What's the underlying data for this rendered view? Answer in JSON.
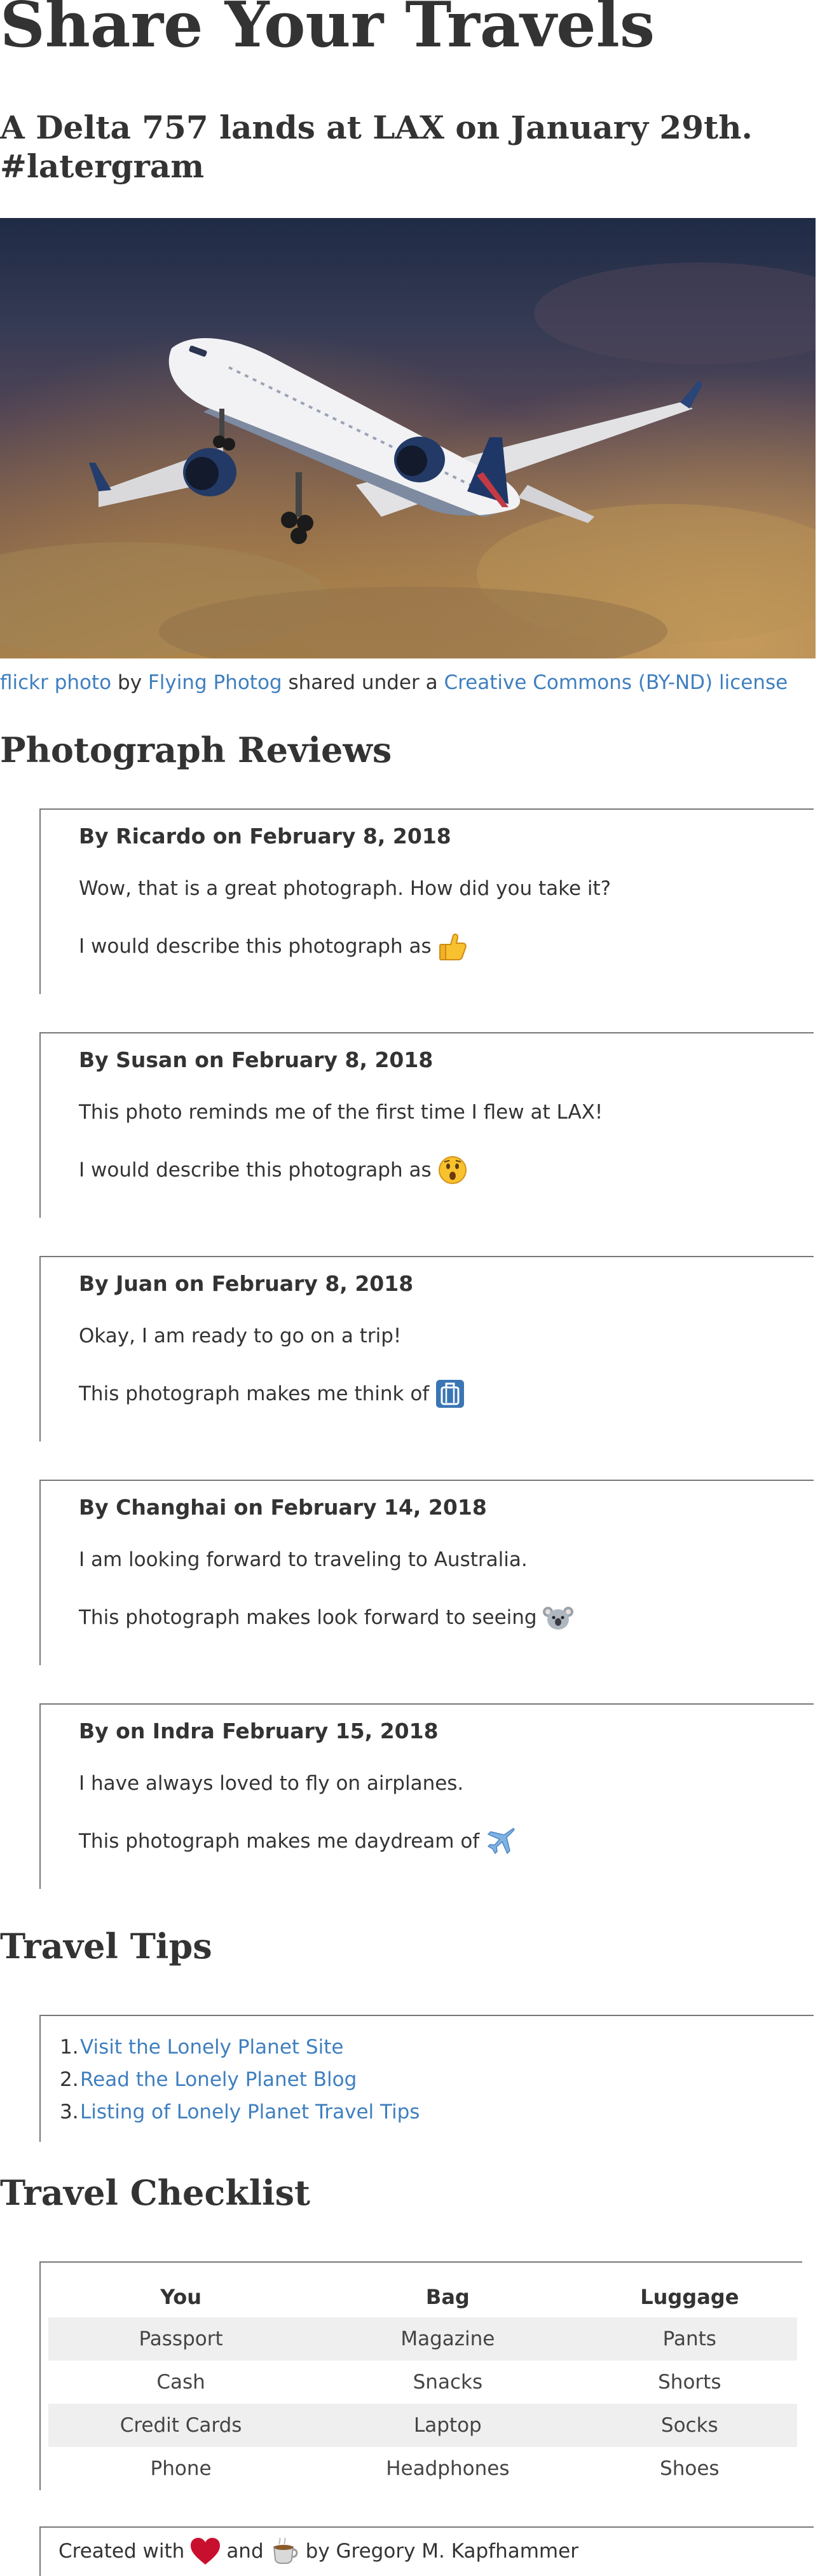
{
  "page": {
    "title": "Share Your Travels",
    "photo_title": "A Delta 757 lands at LAX on January 29th. #latergram"
  },
  "photo": {
    "alt_subject": "Delta 757 airplane in flight"
  },
  "caption": {
    "link1": "flickr photo",
    "by": "by",
    "link2": "Flying Photog",
    "shared": "shared under a",
    "link3": "Creative Commons (BY-ND) license"
  },
  "reviews": {
    "heading": "Photograph Reviews",
    "items": [
      {
        "author": "By Ricardo on February 8, 2018",
        "comment": "Wow, that is a great photograph. How did you take it?",
        "emoji_text": "I would describe this photograph as",
        "emoji_icon": "thumbs-up-icon"
      },
      {
        "author": "By Susan on February 8, 2018",
        "comment": "This photo reminds me of the first time I flew at LAX!",
        "emoji_text": "I would describe this photograph as",
        "emoji_icon": "astonished-face-icon"
      },
      {
        "author": "By Juan on February 8, 2018",
        "comment": "Okay, I am ready to go on a trip!",
        "emoji_text": "This photograph makes me think of",
        "emoji_icon": "luggage-icon"
      },
      {
        "author": "By Changhai on February 14, 2018",
        "comment": "I am looking forward to traveling to Australia.",
        "emoji_text": "This photograph makes look forward to seeing",
        "emoji_icon": "koala-icon"
      },
      {
        "author": "By on Indra February 15, 2018",
        "comment": "I have always loved to fly on airplanes.",
        "emoji_text": "This photograph makes me daydream of",
        "emoji_icon": "airplane-icon"
      }
    ]
  },
  "tips": {
    "heading": "Travel Tips",
    "items": [
      {
        "num": "1.",
        "label": "Visit the Lonely Planet Site"
      },
      {
        "num": "2.",
        "label": "Read the Lonely Planet Blog"
      },
      {
        "num": "3.",
        "label": "Listing of Lonely Planet Travel Tips"
      }
    ]
  },
  "checklist": {
    "heading": "Travel Checklist",
    "columns": [
      "You",
      "Bag",
      "Luggage"
    ],
    "rows": [
      [
        "Passport",
        "Magazine",
        "Pants"
      ],
      [
        "Cash",
        "Snacks",
        "Shorts"
      ],
      [
        "Credit Cards",
        "Laptop",
        "Socks"
      ],
      [
        "Phone",
        "Headphones",
        "Shoes"
      ]
    ]
  },
  "footer": {
    "created_with": "Created with",
    "and": "and",
    "by": "by Gregory M. Kapfhammer",
    "heart_icon": "heart-icon",
    "coffee_icon": "coffee-icon"
  },
  "colors": {
    "link": "#3f7fbf",
    "text": "#333333",
    "border": "#777777",
    "stripe": "#efefef"
  }
}
